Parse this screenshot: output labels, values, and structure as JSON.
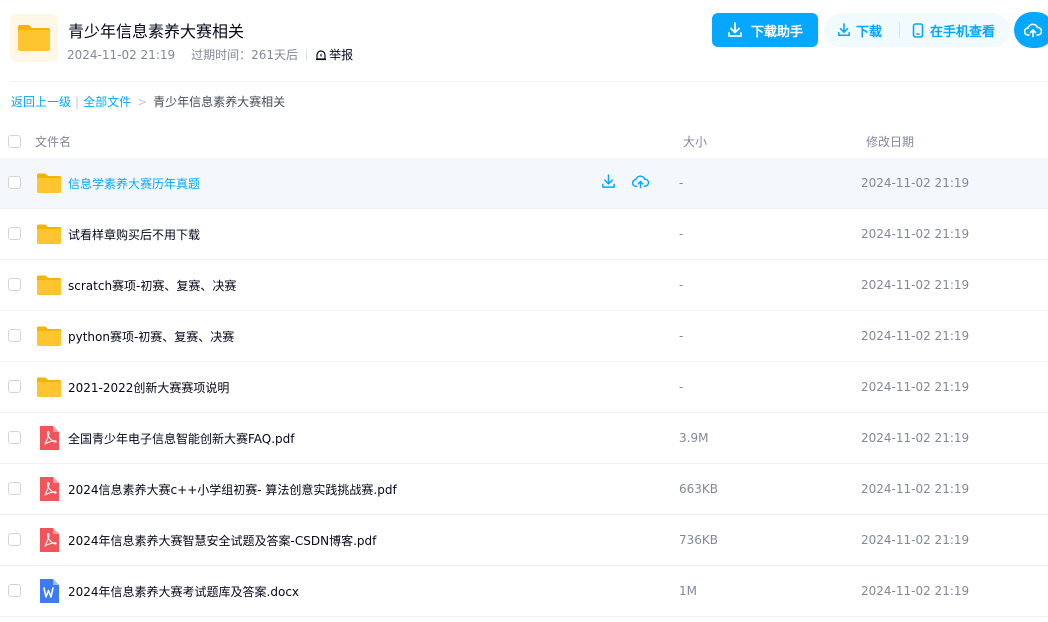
{
  "share": {
    "title": "青少年信息素养大赛相关",
    "created": "2024-11-02 21:19",
    "expire_label": "过期时间：",
    "expire_value": "261天后",
    "report_label": "举报"
  },
  "actions": {
    "helper_label": "下载助手",
    "download_label": "下载",
    "phone_label": "在手机查看"
  },
  "breadcrumb": {
    "back_label": "返回上一级",
    "all_label": "全部文件",
    "current": "青少年信息素养大赛相关"
  },
  "table": {
    "headers": {
      "name": "文件名",
      "size": "大小",
      "date": "修改日期"
    },
    "rows": [
      {
        "name": "信息学素养大赛历年真题",
        "size": "-",
        "date": "2024-11-02 21:19",
        "type": "folder"
      },
      {
        "name": "试看样章购买后不用下载",
        "size": "-",
        "date": "2024-11-02 21:19",
        "type": "folder"
      },
      {
        "name": "scratch赛项-初赛、复赛、决赛",
        "size": "-",
        "date": "2024-11-02 21:19",
        "type": "folder"
      },
      {
        "name": "python赛项-初赛、复赛、决赛",
        "size": "-",
        "date": "2024-11-02 21:19",
        "type": "folder"
      },
      {
        "name": "2021-2022创新大赛赛项说明",
        "size": "-",
        "date": "2024-11-02 21:19",
        "type": "folder"
      },
      {
        "name": "全国青少年电子信息智能创新大赛FAQ.pdf",
        "size": "3.9M",
        "date": "2024-11-02 21:19",
        "type": "pdf"
      },
      {
        "name": "2024信息素养大赛c++小学组初赛- 算法创意实践挑战赛.pdf",
        "size": "663KB",
        "date": "2024-11-02 21:19",
        "type": "pdf"
      },
      {
        "name": "2024年信息素养大赛智慧安全试题及答案-CSDN博客.pdf",
        "size": "736KB",
        "date": "2024-11-02 21:19",
        "type": "pdf"
      },
      {
        "name": "2024年信息素养大赛考试题库及答案.docx",
        "size": "1M",
        "date": "2024-11-02 21:19",
        "type": "docx"
      }
    ]
  },
  "colors": {
    "accent": "#06a7ff",
    "folder": "#ffc530",
    "pdf": "#f2545b",
    "docx": "#3d7af5"
  }
}
